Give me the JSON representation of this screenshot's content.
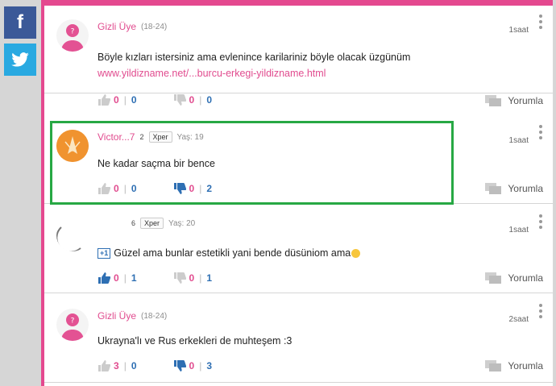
{
  "share": {
    "facebook_icon": "facebook-icon",
    "twitter_icon": "twitter-icon"
  },
  "colors": {
    "accent": "#e4498f",
    "blue": "#2e6fb3",
    "highlight": "#27a844"
  },
  "comments": [
    {
      "username": "Gizli Üye",
      "age": "(18-24)",
      "level": "",
      "xper": "",
      "yas": "",
      "time": "1saat",
      "text": "Böyle kızları istersiniz ama evlenince karilariniz böyle olacak üzgünüm",
      "link": "www.yildizname.net/...burcu-erkegi-yildizname.html",
      "up": "0",
      "down": "0",
      "up2": "0",
      "down2": "0",
      "reply": "Yorumla"
    },
    {
      "username": "Victor...7",
      "age": "",
      "level": "2",
      "xper": "Xper",
      "yas": "Yaş: 19",
      "time": "1saat",
      "text": "Ne kadar saçma bir bence",
      "link": "",
      "up": "0",
      "down": "0",
      "up2": "0",
      "down2": "2",
      "reply": "Yorumla"
    },
    {
      "username": "",
      "age": "",
      "level": "6",
      "xper": "Xper",
      "yas": "Yaş: 20",
      "time": "1saat",
      "badge": "+1",
      "text": "Güzel ama bunlar estetikli yani bende düsüniom ama",
      "link": "",
      "up": "0",
      "down": "1",
      "up2": "0",
      "down2": "1",
      "reply": "Yorumla"
    },
    {
      "username": "Gizli Üye",
      "age": "(18-24)",
      "level": "",
      "xper": "",
      "yas": "",
      "time": "2saat",
      "text": "Ukrayna'lı ve Rus erkekleri de muhteşem :3",
      "link": "",
      "up": "3",
      "down": "0",
      "up2": "0",
      "down2": "3",
      "reply": "Yorumla"
    }
  ]
}
